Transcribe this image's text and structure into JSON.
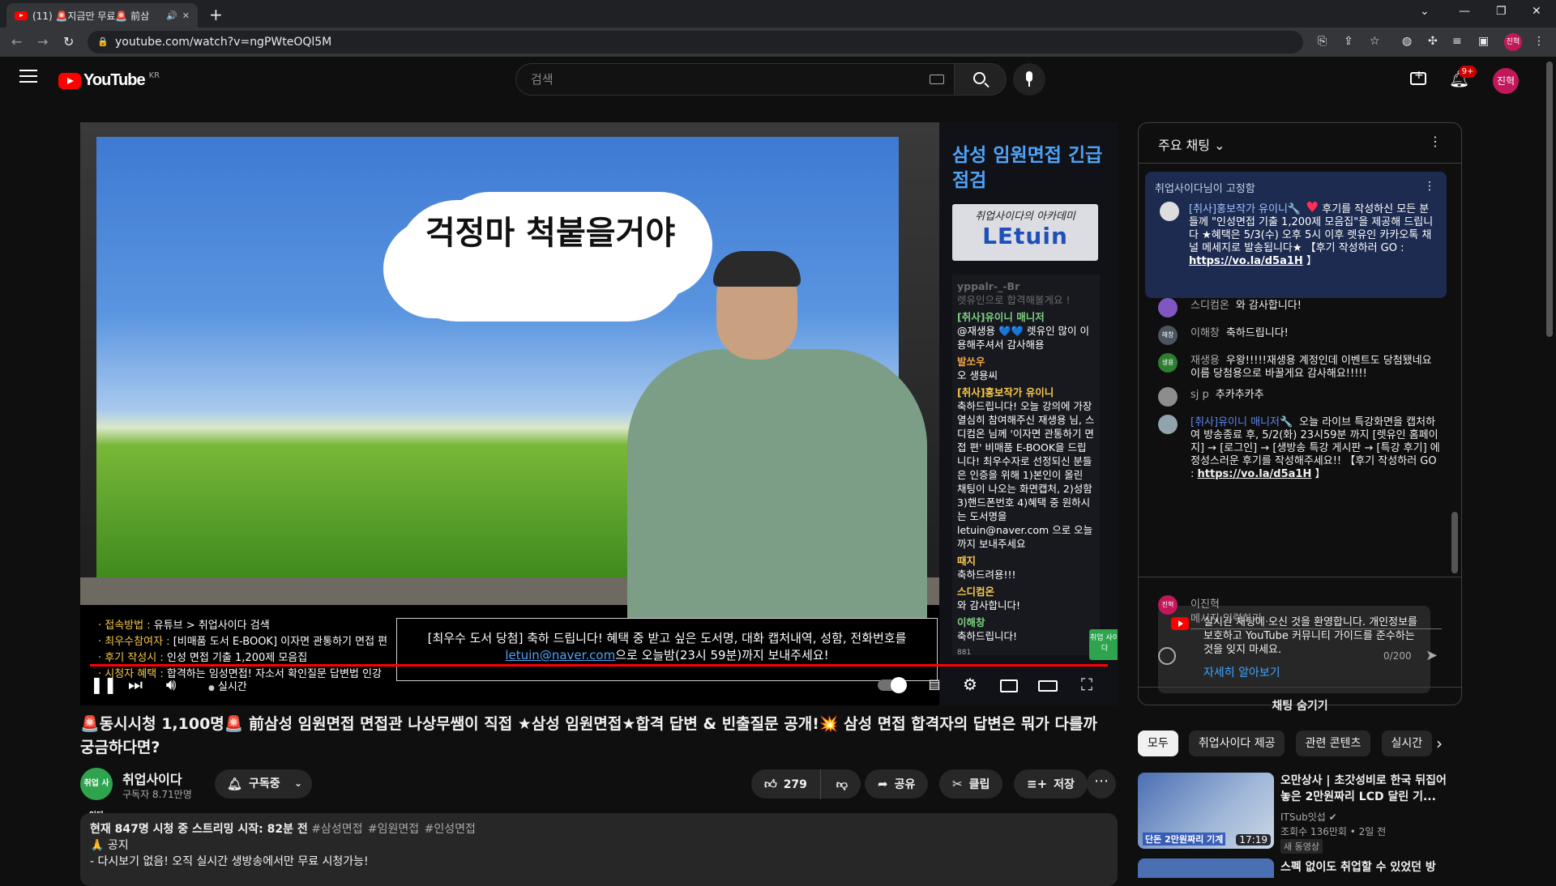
{
  "browser": {
    "tab_count": "(11)",
    "tab_title": "🚨지금만 무료🚨 前삼",
    "url": "youtube.com/watch?v=ngPWteOQl5M",
    "accent": "#35363a"
  },
  "masthead": {
    "logo_text": "YouTube",
    "region": "KR",
    "search_placeholder": "검색",
    "notification_count": "9+",
    "avatar_text": "진혁"
  },
  "player": {
    "cloud_text": "걱정마 척붙을거야",
    "side_title": "삼성 임원면접 긴급점검",
    "logo_sub": "취업사이다의 아카데미",
    "logo_main": "LEtuin",
    "side_chat": [
      {
        "name": "yppalr-_-Br",
        "text": "렛유인으로 합격해볼게요 !",
        "style": "faded"
      },
      {
        "name": "[취사]유이니 매니저",
        "text": "@재생용 💙💙 렛유인 많이 이용해주셔서 감사해용",
        "style": "g"
      },
      {
        "name": "발쏘우",
        "text": "오 생용씨",
        "style": "o"
      },
      {
        "name": "[취사]홍보작가 유이니",
        "text": "축하드립니다! 오늘 강의에 가장 열심히 참여해주신 재생용 님, 스디컴온 님께 '이자면 관통하기 면접 편' 비매품 E-BOOK을 드립니다! 최우수자로 선정되신 분들은 인증을 위해 1)본인이 올린 채팅이 나오는 화면캡처, 2)성함 3)핸드폰번호 4)혜택 중 원하시는 도서명을 letuin@naver.com 으로 오늘까지 보내주세요",
        "style": ""
      },
      {
        "name": "때지",
        "text": "축하드려용!!!",
        "style": ""
      },
      {
        "name": "스디컴온",
        "text": "와 감사합니다!",
        "style": ""
      },
      {
        "name": "이해창",
        "text": "축하드립니다!",
        "style": "g"
      }
    ],
    "side_badge": "취업 사이다",
    "side_count": "881",
    "banner_left": [
      {
        "k": "· 접속방법 :",
        "v": "유튜브 > 취업사이다 검색"
      },
      {
        "k": "· 최우수참여자 :",
        "v": "[비매품 도서 E-BOOK] 이자면 관통하기 면접 편"
      },
      {
        "k": "· 후기 작성시 :",
        "v": "인성 면접 기출 1,200제 모음집"
      },
      {
        "k": "· 시청자 혜택 :",
        "v": "합격하는 임성면접! 자소서 확인질문 답변법 인강"
      }
    ],
    "banner_line1": "[최우수 도서 당첨] 축하 드립니다! 혜택 중 받고 싶은 도서명, 대화 캡처내역, 성함, 전화번호를",
    "banner_email": "letuin@naver.com",
    "banner_line2_rest": "으로 오늘밤(23시 59분)까지 보내주세요!",
    "live_label": "실시간",
    "progress": 1.0
  },
  "video": {
    "title": "🚨동시시청 1,100명🚨 前삼성 임원면접 면접관 나상무쌤이 직접 ★삼성 임원면접★합격 답변 & 빈출질문 공개!💥 삼성 면접 합격자의 답변은 뭐가 다를까 궁금하다면?",
    "channel": "취업사이다",
    "channel_avatar": "취업 사이다",
    "subscribers": "구독자 8.71만명",
    "subscribe_label": "구독중",
    "likes": "279",
    "share_label": "공유",
    "clip_label": "클립",
    "save_label": "저장",
    "desc_meta": "현재 847명 시청 중 스트리밍 시작: 82분 전",
    "tags": [
      "#삼성면접",
      "#임원면접",
      "#인성면접"
    ],
    "desc_line1": "🙏 공지",
    "desc_line2": "- 다시보기 없음! 오직 실시간 생방송에서만 무료 시청가능!"
  },
  "chat": {
    "mode": "주요 채팅",
    "pinned_by": "취업사이다님이 고정함",
    "pinned_author": "[취사]홍보작가 유이니🔧",
    "pinned_text": "후기를 작성하신 모든 분들께 \"인성면접 기출 1,200제 모음집\"을 제공해 드립니다 ★혜택은 5/3(수) 오후 5시 이후 렛유인 카카오톡 채널 메세지로 발송됩니다★ 【후기 작성하러 GO :",
    "pinned_link": "https://vo.la/d5a1H",
    "pinned_end": "】",
    "messages": [
      {
        "author": "스디컴온",
        "text": "와 감사합니다!",
        "color": "#7e57c2",
        "av": "",
        "mod": false
      },
      {
        "author": "이해창",
        "text": "축하드립니다!",
        "color": "#4a5560",
        "av": "해창",
        "mod": false
      },
      {
        "author": "재생용",
        "text": "우왕!!!!!재생용 계정인데 이벤트도 당첨됐네요 이름 당첨용으로 바꿀게요 감사해요!!!!!",
        "color": "#2e7d32",
        "av": "생용",
        "mod": false
      },
      {
        "author": "sj p",
        "text": "추카추카추",
        "color": "#8d8d8d",
        "av": "",
        "mod": false
      },
      {
        "author": "[취사]유이니 매니저🔧",
        "text": "오늘 라이브 특강화면을 캡처하여 방송종료 후, 5/2(화) 23시59분 까지 [렛유인 홈페이지] → [로그인] → [생방송 특강 게시판 → [특강 후기] 에 정성스러운 후기를 작성해주세요!! 【후기 작성하러 GO :",
        "link": "https://vo.la/d5a1H",
        "end": "】",
        "color": "#90a4ae",
        "av": "",
        "mod": true
      }
    ],
    "welcome_text": "실시간 채팅에 오신 것을 환영합니다. 개인정보를 보호하고 YouTube 커뮤니티 가이드를 준수하는 것을 잊지 마세요.",
    "learn_more": "자세히 알아보기",
    "user_name": "이진혁",
    "user_avatar": "진혁",
    "input_placeholder": "메시지 입력하기...",
    "char_count": "0/200",
    "hide_label": "채팅 숨기기"
  },
  "recommendations": {
    "chips": [
      "모두",
      "취업사이다 제공",
      "관련 콘텐츠",
      "실시간"
    ],
    "items": [
      {
        "title": "오만상사 | 초갓성비로 한국 뒤집어놓은 2만원짜리 LCD 달린 기...",
        "channel": "ITSub잇섭",
        "meta": "조회수 136만회 • 2일 전",
        "badge": "새 동영상",
        "duration": "17:19",
        "thumb_caption": "단돈 2만원짜리 기계"
      },
      {
        "title": "스펙 없이도 취업할 수 있었던 방",
        "channel": "",
        "meta": "",
        "badge": "",
        "duration": "",
        "thumb_caption": ""
      }
    ]
  }
}
